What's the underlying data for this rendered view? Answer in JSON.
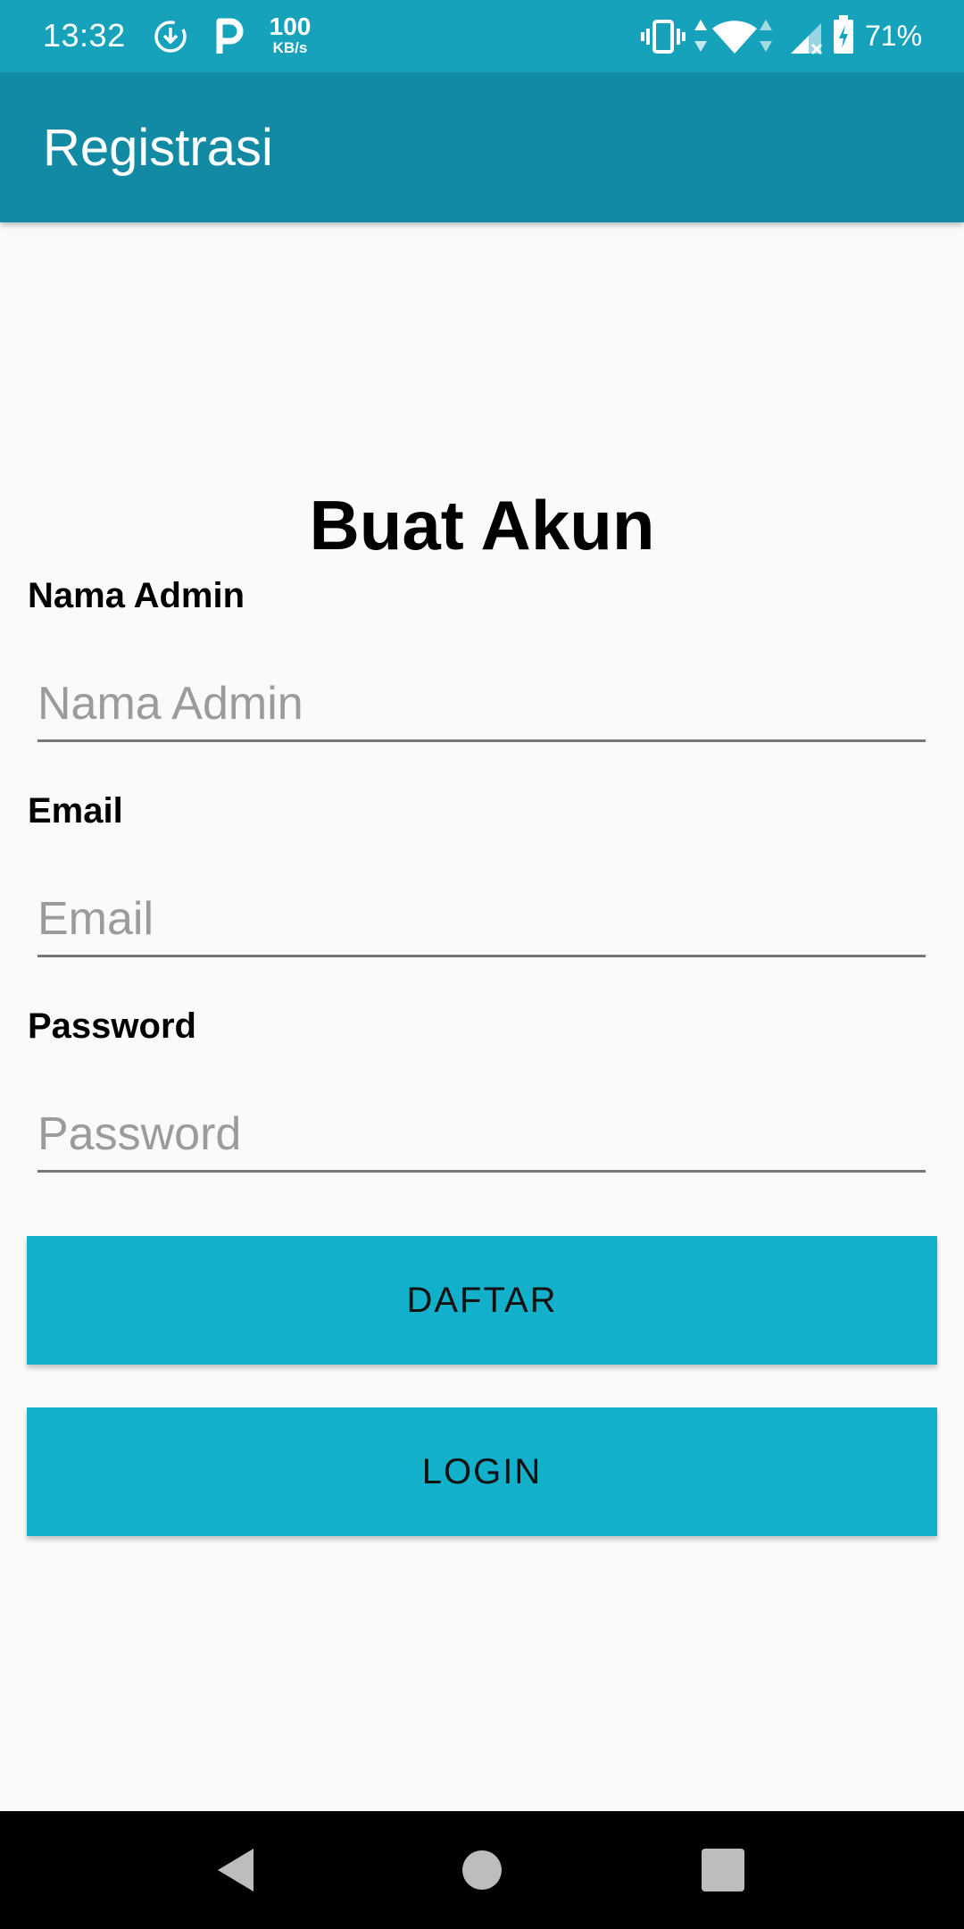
{
  "status_bar": {
    "time": "13:32",
    "speed_value": "100",
    "speed_unit": "KB/s",
    "battery_percent": "71%",
    "icons": [
      "download-icon",
      "parking-icon",
      "vibrate-icon",
      "data-arrows-icon",
      "wifi-icon",
      "signal-icon",
      "battery-icon"
    ]
  },
  "app_bar": {
    "title": "Registrasi"
  },
  "form": {
    "heading": "Buat Akun",
    "fields": [
      {
        "label": "Nama Admin",
        "placeholder": "Nama Admin",
        "value": ""
      },
      {
        "label": "Email",
        "placeholder": "Email",
        "value": ""
      },
      {
        "label": "Password",
        "placeholder": "Password",
        "value": ""
      }
    ],
    "register_button": "DAFTAR",
    "login_button": "LOGIN"
  },
  "nav_bar": {
    "icons": [
      "back-icon",
      "home-icon",
      "recents-icon"
    ]
  },
  "colors": {
    "status_bar": "#17a2bc",
    "app_bar": "#138aa4",
    "button": "#13b0cc",
    "background": "#fafafa"
  }
}
